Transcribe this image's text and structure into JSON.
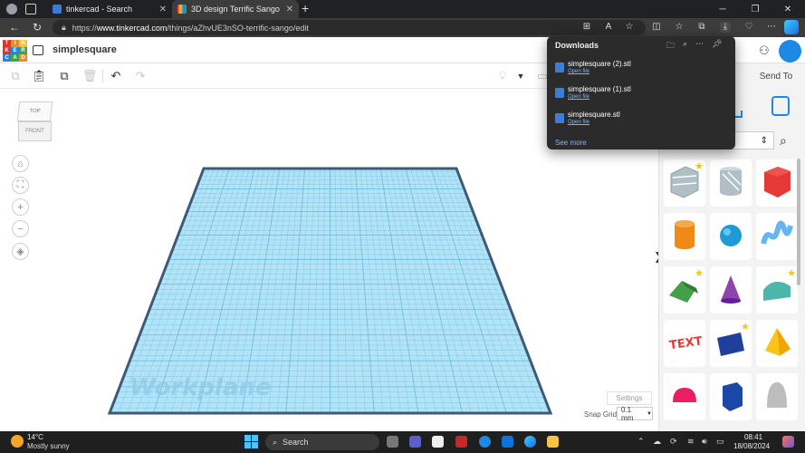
{
  "browser": {
    "tabs": [
      {
        "label": "tinkercad - Search"
      },
      {
        "label": "3D design Terrific Sango - Tinkercad"
      }
    ],
    "url_prefix": "https://",
    "url_host": "www.tinkercad.com",
    "url_path": "/things/aZhvUE3nSO-terrific-sango/edit"
  },
  "downloads": {
    "title": "Downloads",
    "items": [
      {
        "name": "simplesquare (2).stl",
        "action": "Open file"
      },
      {
        "name": "simplesquare (1).stl",
        "action": "Open file"
      },
      {
        "name": "simplesquare.stl",
        "action": "Open file"
      }
    ],
    "see_more": "See more"
  },
  "tinkercad": {
    "logo_letters": [
      "T",
      "I",
      "N",
      "K",
      "E",
      "R",
      "C",
      "A",
      "D"
    ],
    "logo_colors": [
      "#e5322d",
      "#f28b1e",
      "#fbc02d",
      "#e5322d",
      "#1e88e5",
      "#43a047",
      "#1e88e5",
      "#43a047",
      "#f28b1e"
    ],
    "design_name": "simplesquare",
    "import_label": "rt",
    "send_to": "Send To",
    "workplane_label": "Workplane",
    "viewcube": {
      "top": "TOP",
      "front": "FRONT"
    },
    "settings": "Settings",
    "snap_grid_label": "Snap Grid",
    "snap_grid_value": "0.1 mm",
    "workplane_color": "#b3e3f7",
    "grid_line_color": "#6fbfe0",
    "border_color": "#3d5a78"
  },
  "shapes": [
    {
      "name": "box-hole",
      "color": "#b0bec5",
      "star": true
    },
    {
      "name": "cylinder-hole",
      "color": "#b0bec5",
      "star": false
    },
    {
      "name": "box",
      "color": "#e53935",
      "star": false
    },
    {
      "name": "cylinder",
      "color": "#ef8a17",
      "star": false
    },
    {
      "name": "sphere",
      "color": "#1e9bd7",
      "star": false
    },
    {
      "name": "scribble",
      "color": "#64b5f6",
      "star": false
    },
    {
      "name": "roof",
      "color": "#43a047",
      "star": true
    },
    {
      "name": "cone",
      "color": "#8e44ad",
      "star": false
    },
    {
      "name": "round-roof",
      "color": "#4db6ac",
      "star": true
    },
    {
      "name": "text",
      "color": "#e53935",
      "star": false
    },
    {
      "name": "wedge",
      "color": "#1e3f9e",
      "star": true
    },
    {
      "name": "pyramid",
      "color": "#f9c51b",
      "star": false
    },
    {
      "name": "half-sphere",
      "color": "#e91e63",
      "star": false
    },
    {
      "name": "polygon",
      "color": "#1a47a8",
      "star": false
    },
    {
      "name": "paraboloid",
      "color": "#bdbdbd",
      "star": false
    }
  ],
  "taskbar": {
    "weather_temp": "14°C",
    "weather_desc": "Mostly sunny",
    "search_label": "Search",
    "time": "08:41",
    "date": "18/08/2024"
  }
}
